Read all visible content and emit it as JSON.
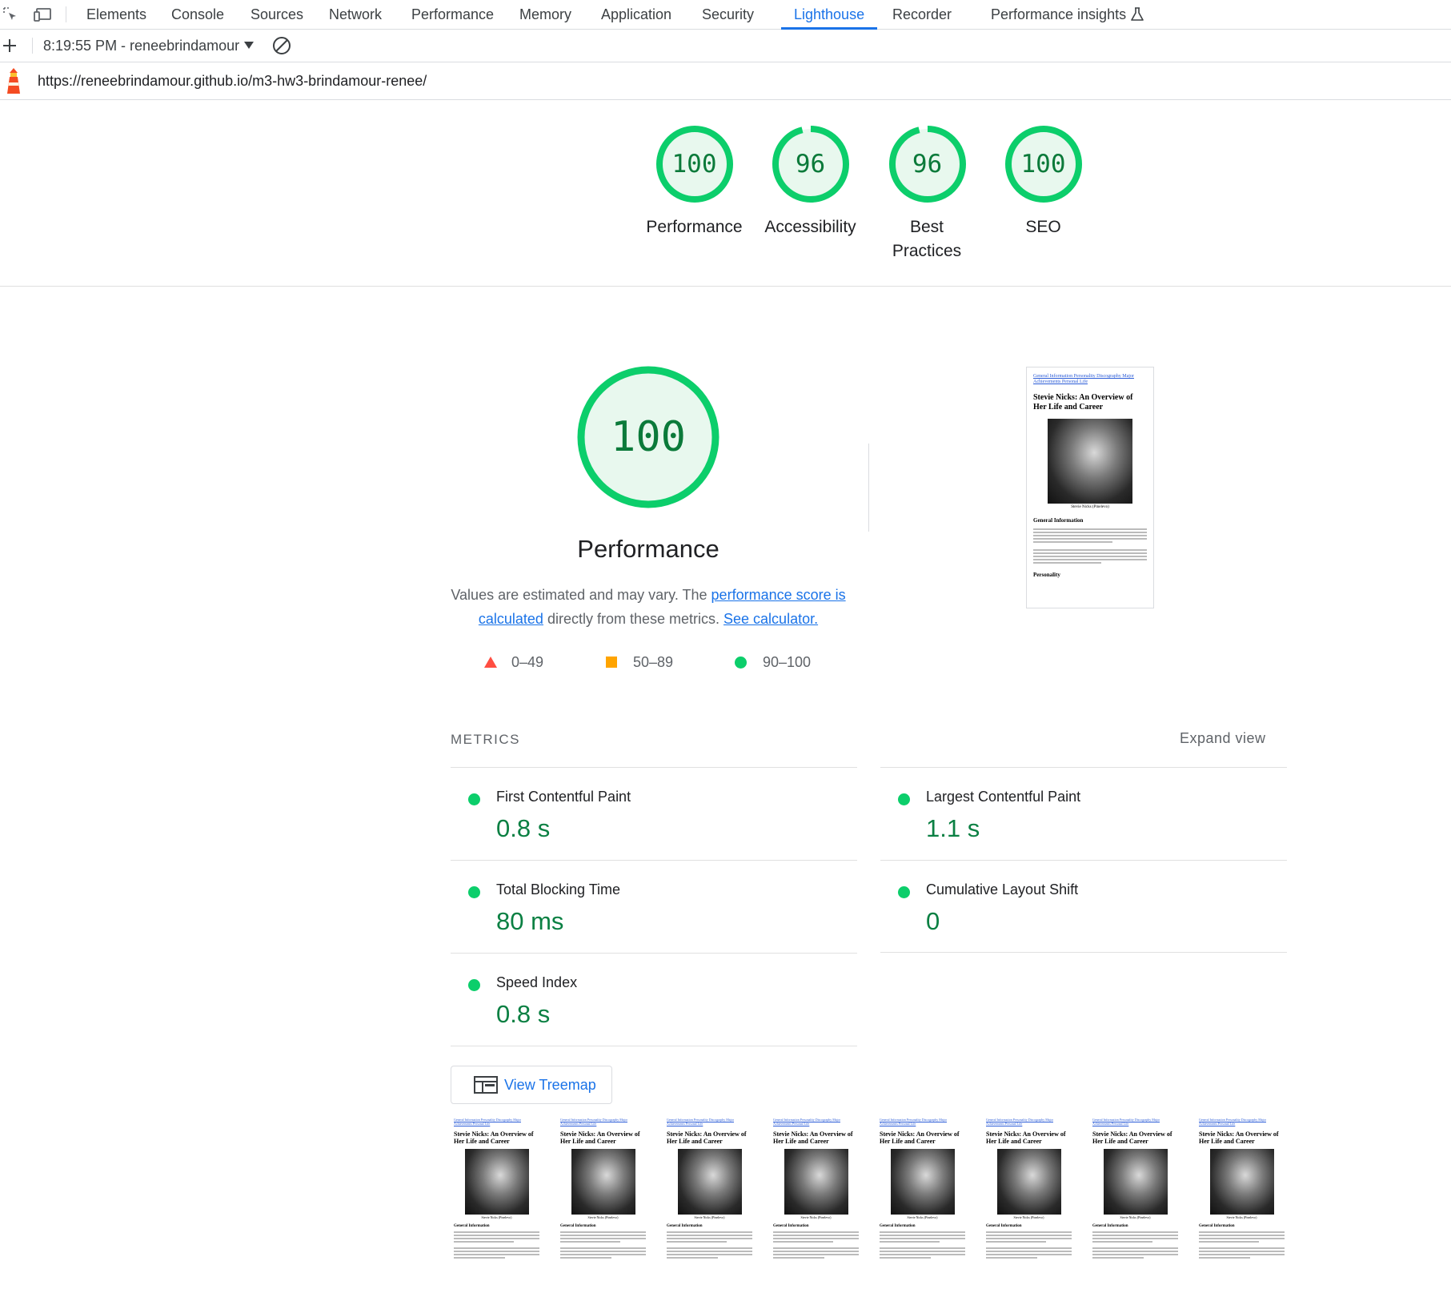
{
  "devtools": {
    "tabs": [
      "Elements",
      "Console",
      "Sources",
      "Network",
      "Performance",
      "Memory",
      "Application",
      "Security",
      "Lighthouse",
      "Recorder",
      "Performance insights"
    ],
    "active_tab": "Lighthouse"
  },
  "toolbar": {
    "report_label": "8:19:55 PM - reneebrindamour"
  },
  "url": "https://reneebrindamour.github.io/m3-hw3-brindamour-renee/",
  "summary": {
    "gauges": [
      {
        "score": "100",
        "label": "Performance",
        "fraction": 1.0
      },
      {
        "score": "96",
        "label": "Accessibility",
        "fraction": 0.96
      },
      {
        "score": "96",
        "label": "Best Practices",
        "fraction": 0.96
      },
      {
        "score": "100",
        "label": "SEO",
        "fraction": 1.0
      }
    ]
  },
  "performance": {
    "score": "100",
    "fraction": 1.0,
    "title": "Performance",
    "desc_prefix": "Values are estimated and may vary. The ",
    "desc_link1": "performance score is calculated",
    "desc_middle": " directly from these metrics. ",
    "desc_link2": "See calculator.",
    "legend": [
      "0–49",
      "50–89",
      "90–100"
    ]
  },
  "colors": {
    "pass": "#0cce6b",
    "pass_text": "#0b8043",
    "average": "#ffa400",
    "fail": "#ff4e42",
    "accent": "#1a73e8"
  },
  "metrics": {
    "heading": "METRICS",
    "expand_label": "Expand view",
    "items": [
      {
        "name": "First Contentful Paint",
        "value": "0.8 s"
      },
      {
        "name": "Largest Contentful Paint",
        "value": "1.1 s"
      },
      {
        "name": "Total Blocking Time",
        "value": "80 ms"
      },
      {
        "name": "Cumulative Layout Shift",
        "value": "0"
      },
      {
        "name": "Speed Index",
        "value": "0.8 s"
      }
    ]
  },
  "treemap": {
    "label": "View Treemap"
  },
  "thumbnail": {
    "nav_links": "General Information Personality Discography Major Achievements Personal Life",
    "title": "Stevie Nicks: An Overview of Her Life and Career",
    "caption": "Stevie Nicks (Pinelevo)",
    "section1": "General Information",
    "section2": "Personality"
  }
}
